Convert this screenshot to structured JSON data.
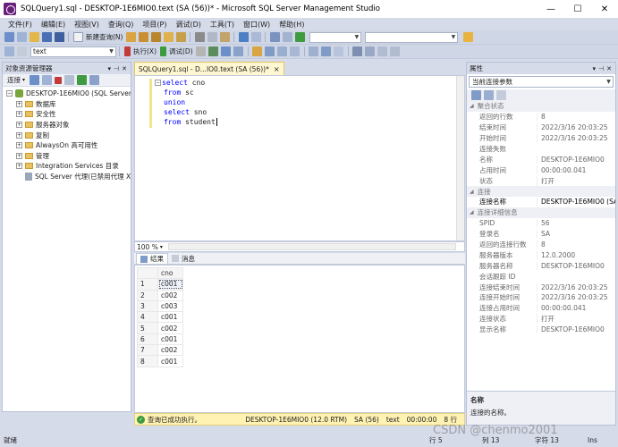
{
  "window": {
    "title": "SQLQuery1.sql - DESKTOP-1E6MIO0.text (SA (56))* - Microsoft SQL Server Management Studio",
    "minimize": "—",
    "maximize": "☐",
    "close": "✕"
  },
  "menu": [
    "文件(F)",
    "编辑(E)",
    "视图(V)",
    "查询(Q)",
    "项目(P)",
    "调试(D)",
    "工具(T)",
    "窗口(W)",
    "帮助(H)"
  ],
  "toolbar": {
    "new_query": "新建查询(N)",
    "database_combo": "text",
    "execute": "执行(X)",
    "debug": "调试(D)"
  },
  "object_explorer": {
    "title": "对象资源管理器",
    "connect": "连接",
    "tree": [
      {
        "label": "DESKTOP-1E6MIO0 (SQL Server",
        "level": 0,
        "expander": "−",
        "icon": "server-icon"
      },
      {
        "label": "数据库",
        "level": 1,
        "expander": "+",
        "icon": "folder-icon"
      },
      {
        "label": "安全性",
        "level": 1,
        "expander": "+",
        "icon": "folder-icon"
      },
      {
        "label": "服务器对象",
        "level": 1,
        "expander": "+",
        "icon": "folder-icon"
      },
      {
        "label": "复制",
        "level": 1,
        "expander": "+",
        "icon": "folder-icon"
      },
      {
        "label": "AlwaysOn 高可用性",
        "level": 1,
        "expander": "+",
        "icon": "folder-icon"
      },
      {
        "label": "管理",
        "level": 1,
        "expander": "+",
        "icon": "folder-icon"
      },
      {
        "label": "Integration Services 目录",
        "level": 1,
        "expander": "+",
        "icon": "folder-icon"
      },
      {
        "label": "SQL Server 代理(已禁用代理 X",
        "level": 1,
        "expander": "",
        "icon": "agent-icon"
      }
    ]
  },
  "document": {
    "tab_label": "SQLQuery1.sql - D...IO0.text (SA (56))*",
    "tab_close": "×",
    "code": [
      {
        "keyword": "select",
        "rest": " cno"
      },
      {
        "keyword": "from",
        "rest": " sc"
      },
      {
        "keyword": "union",
        "rest": ""
      },
      {
        "keyword": "select",
        "rest": " sno"
      },
      {
        "keyword": "from",
        "rest": " student"
      }
    ],
    "zoom": "100 %"
  },
  "results": {
    "tab_results": "结果",
    "tab_messages": "消息",
    "column": "cno",
    "rows": [
      {
        "num": "1",
        "cno": "c001"
      },
      {
        "num": "2",
        "cno": "c002"
      },
      {
        "num": "3",
        "cno": "c003"
      },
      {
        "num": "4",
        "cno": "c001"
      },
      {
        "num": "5",
        "cno": "c002"
      },
      {
        "num": "6",
        "cno": "c001"
      },
      {
        "num": "7",
        "cno": "c002"
      },
      {
        "num": "8",
        "cno": "c001"
      }
    ]
  },
  "query_status": {
    "message": "查询已成功执行。",
    "server": "DESKTOP-1E6MIO0 (12.0 RTM)",
    "user": "SA (56)",
    "database": "text",
    "elapsed": "00:00:00",
    "rows": "8 行"
  },
  "properties": {
    "title": "属性",
    "selector": "当前连接参数",
    "rows": [
      {
        "type": "cat",
        "name": "聚合状态"
      },
      {
        "type": "prop",
        "name": "返回的行数",
        "value": "8"
      },
      {
        "type": "prop",
        "name": "结束时间",
        "value": "2022/3/16 20:03:25"
      },
      {
        "type": "prop",
        "name": "开始时间",
        "value": "2022/3/16 20:03:25"
      },
      {
        "type": "prop",
        "name": "连接失败",
        "value": ""
      },
      {
        "type": "prop",
        "name": "名称",
        "value": "DESKTOP-1E6MIO0"
      },
      {
        "type": "prop",
        "name": "占用时间",
        "value": "00:00:00.041"
      },
      {
        "type": "prop",
        "name": "状态",
        "value": "打开"
      },
      {
        "type": "cat",
        "name": "连接"
      },
      {
        "type": "prop",
        "name": "连接名称",
        "value": "DESKTOP-1E6MIO0 (SA",
        "selected": true
      },
      {
        "type": "cat",
        "name": "连接详细信息"
      },
      {
        "type": "prop",
        "name": "SPID",
        "value": "56"
      },
      {
        "type": "prop",
        "name": "登录名",
        "value": "SA"
      },
      {
        "type": "prop",
        "name": "返回的连接行数",
        "value": "8"
      },
      {
        "type": "prop",
        "name": "服务器版本",
        "value": "12.0.2000"
      },
      {
        "type": "prop",
        "name": "服务器名称",
        "value": "DESKTOP-1E6MIO0"
      },
      {
        "type": "prop",
        "name": "会话跟踪 ID",
        "value": ""
      },
      {
        "type": "prop",
        "name": "连接结束时间",
        "value": "2022/3/16 20:03:25"
      },
      {
        "type": "prop",
        "name": "连接开始时间",
        "value": "2022/3/16 20:03:25"
      },
      {
        "type": "prop",
        "name": "连接占用时间",
        "value": "00:00:00.041"
      },
      {
        "type": "prop",
        "name": "连接状态",
        "value": "打开"
      },
      {
        "type": "prop",
        "name": "显示名称",
        "value": "DESKTOP-1E6MIO0"
      }
    ],
    "desc_title": "名称",
    "desc_text": "连接的名称。"
  },
  "statusbar": {
    "ready": "就绪",
    "line": "行 5",
    "col": "列 13",
    "ch": "字符 13",
    "ins": "Ins"
  },
  "watermark": "CSDN @chenmo2001"
}
